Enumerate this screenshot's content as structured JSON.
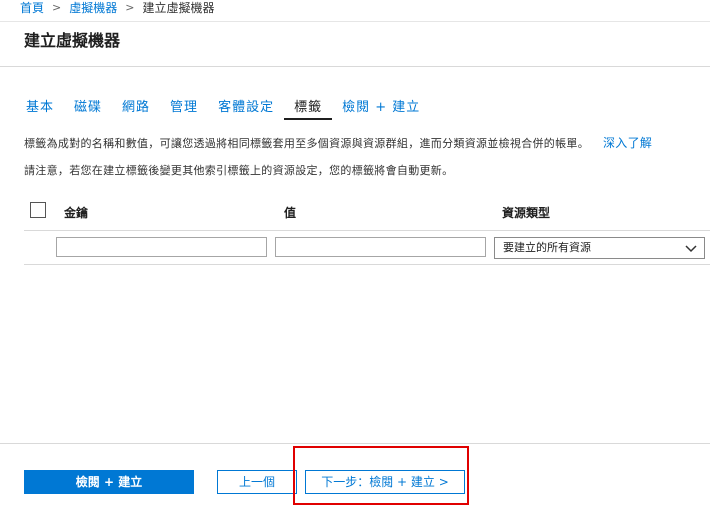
{
  "breadcrumb": {
    "home": "首頁",
    "vms": "虛擬機器",
    "current": "建立虛擬機器",
    "separator": ">"
  },
  "page_title": "建立虛擬機器",
  "tabs": [
    {
      "label": "基本"
    },
    {
      "label": "磁碟"
    },
    {
      "label": "網路"
    },
    {
      "label": "管理"
    },
    {
      "label": "客體設定"
    },
    {
      "label": "標籤"
    },
    {
      "label": "檢閱 + 建立"
    }
  ],
  "active_tab": "標籤",
  "description": {
    "text": "標籤為成對的名稱和數值，可讓您透過將相同標籤套用至多個資源與資源群組，進而分類資源並檢視合併的帳單。",
    "link": "深入了解"
  },
  "notice": "請注意，若您在建立標籤後變更其他索引標籤上的資源設定，您的標籤將會自動更新。",
  "table": {
    "headers": {
      "key": "金鑰",
      "value": "值",
      "resource_type": "資源類型"
    },
    "row": {
      "key": "",
      "value": "",
      "resource_type": "要建立的所有資源"
    }
  },
  "footer": {
    "review_create": "檢閱 + 建立",
    "previous": "上一個",
    "next": "下一步：檢閱 + 建立 >"
  },
  "colors": {
    "accent": "#0078d4",
    "highlight": "#e00000"
  }
}
